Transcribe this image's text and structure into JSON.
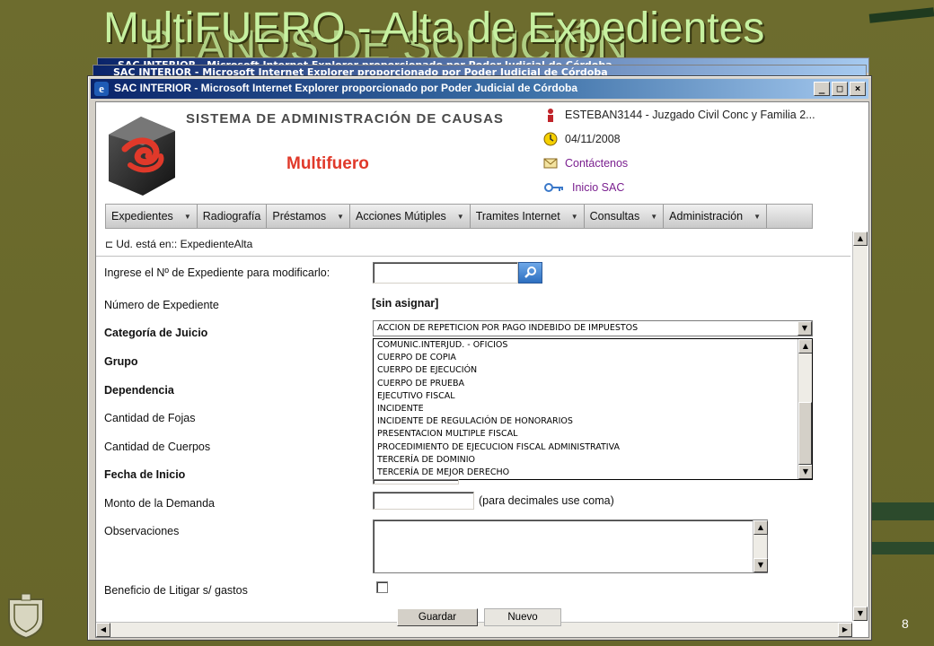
{
  "slide": {
    "title": "MultiFUERO - Alta de Expedientes",
    "ghost_title": "PLANOS DE SOLUCIÓN",
    "page_number": "8"
  },
  "window": {
    "title": "SAC INTERIOR - Microsoft Internet Explorer proporcionado por Poder Judicial de Córdoba",
    "stack_title": "SAC INTERIOR - Microsoft Internet Explorer proporcionado por Poder Judicial de Córdoba",
    "minimize": "_",
    "maximize": "□",
    "close": "×"
  },
  "header": {
    "app_name": "SISTEMA DE ADMINISTRACIÓN DE CAUSAS",
    "module": "Multifuero",
    "user": "ESTEBAN3144 - Juzgado Civil Conc y Familia 2...",
    "date": "04/11/2008",
    "contact": "Contáctenos",
    "home": "Inicio SAC"
  },
  "menu": [
    {
      "label": "Expedientes",
      "has_dropdown": true
    },
    {
      "label": "Radiografía",
      "has_dropdown": false
    },
    {
      "label": "Préstamos",
      "has_dropdown": true
    },
    {
      "label": "Acciones Mútiples",
      "has_dropdown": true
    },
    {
      "label": "Tramites Internet",
      "has_dropdown": true
    },
    {
      "label": "Consultas",
      "has_dropdown": true
    },
    {
      "label": "Administración",
      "has_dropdown": true
    }
  ],
  "breadcrumb": "Ud. está en:: ExpedienteAlta",
  "form": {
    "search_label": "Ingrese el Nº de Expediente para modificarlo:",
    "search_value": "",
    "numero_label": "Número de Expediente",
    "numero_value": "[sin asignar]",
    "categoria_label": "Categoría de Juicio",
    "categoria_selected": "ACCION DE REPETICION POR PAGO INDEBIDO DE IMPUESTOS",
    "grupo_label": "Grupo",
    "dependencia_label": "Dependencia",
    "fojas_label": "Cantidad de Fojas",
    "cuerpos_label": "Cantidad de Cuerpos",
    "fecha_label": "Fecha de Inicio",
    "monto_label": "Monto de la Demanda",
    "monto_hint": "(para decimales use coma)",
    "observaciones_label": "Observaciones",
    "beneficio_label": "Beneficio de Litigar s/ gastos",
    "beneficio_checked": false
  },
  "categoria_options": [
    "COMUNIC.INTERJUD. - OFICIOS",
    "CUERPO DE COPIA",
    "CUERPO DE EJECUCIÓN",
    "CUERPO DE PRUEBA",
    "EJECUTIVO FISCAL",
    "INCIDENTE",
    "INCIDENTE DE REGULACIÓN DE HONORARIOS",
    "PRESENTACION MULTIPLE FISCAL",
    "PROCEDIMIENTO DE EJECUCION FISCAL ADMINISTRATIVA",
    "TERCERÍA DE DOMINIO",
    "TERCERÍA DE MEJOR DERECHO"
  ],
  "buttons": {
    "save": "Guardar",
    "new": "Nuevo"
  },
  "colors": {
    "slide_bg": "#6b6a2c",
    "title_green": "#c6f0a0",
    "module_red": "#e0392a",
    "link_purple": "#7a1f8f",
    "titlebar_blue": "#0a246a"
  }
}
